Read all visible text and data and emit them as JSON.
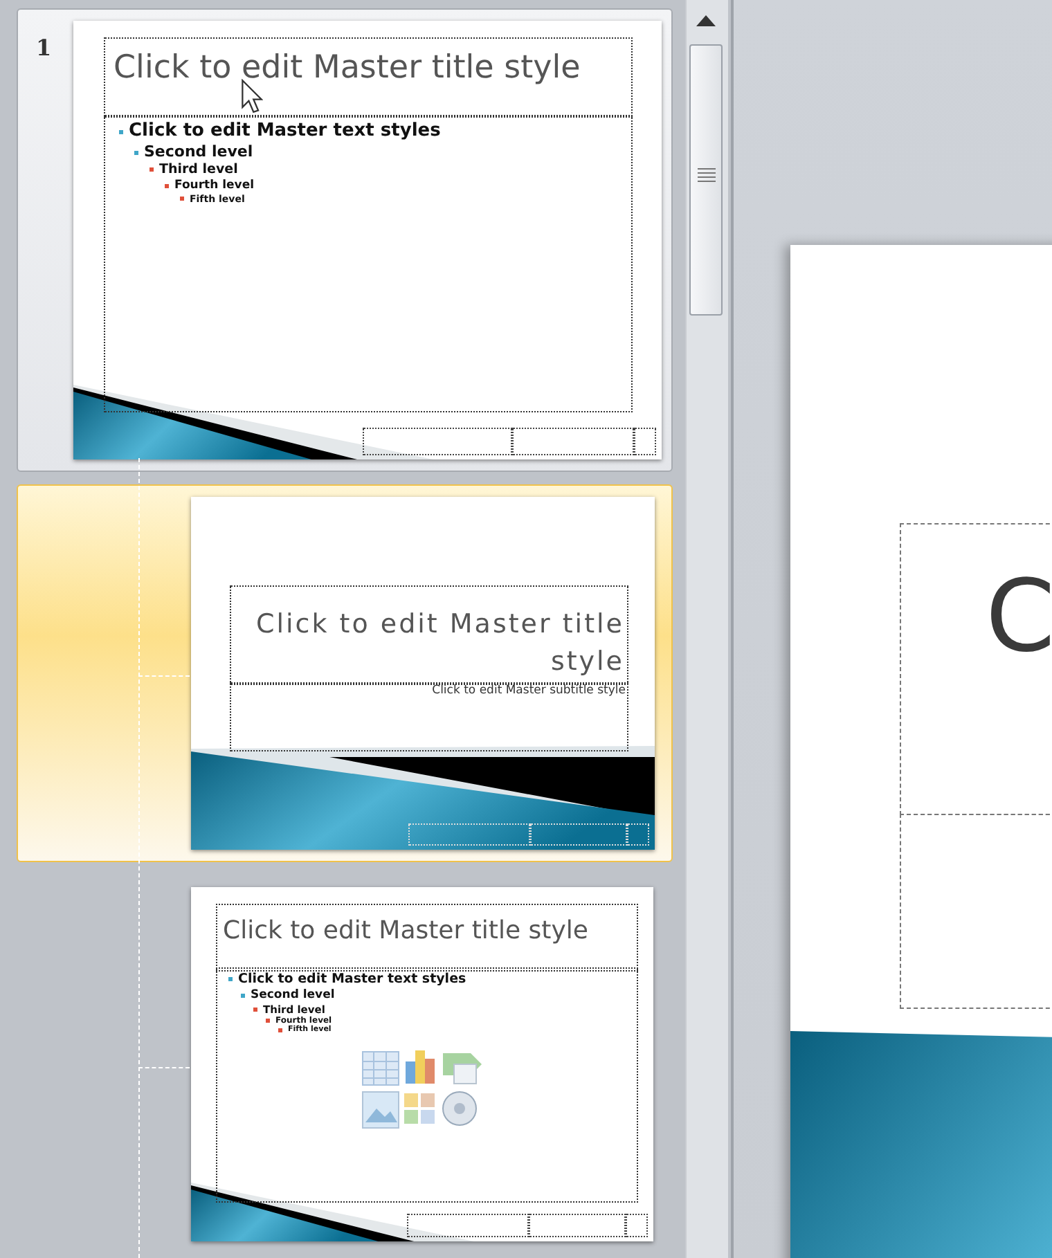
{
  "thumbnails": [
    {
      "kind": "master",
      "number": "1",
      "hovered": true,
      "selected": false,
      "title": "Click to edit Master title style",
      "body": [
        {
          "text": "Click to edit Master  text styles",
          "children": [
            {
              "text": "Second level",
              "children": [
                {
                  "text": "Third level",
                  "children": [
                    {
                      "text": "Fourth level",
                      "children": [
                        {
                          "text": "Fifth level"
                        }
                      ]
                    }
                  ]
                }
              ]
            }
          ]
        }
      ]
    },
    {
      "kind": "title",
      "hovered": false,
      "selected": true,
      "title": "Click to edit Master title style",
      "subtitle": "Click to edit Master  subtitle style"
    },
    {
      "kind": "content",
      "hovered": false,
      "selected": false,
      "title": "Click to edit Master title style",
      "body": [
        {
          "text": "Click to edit Master  text styles",
          "children": [
            {
              "text": "Second level",
              "children": [
                {
                  "text": "Third level",
                  "children": [
                    {
                      "text": "Fourth level",
                      "children": [
                        {
                          "text": "Fifth level"
                        }
                      ]
                    }
                  ]
                }
              ]
            }
          ]
        }
      ]
    }
  ],
  "editor": {
    "slide": {
      "title": "C"
    }
  }
}
